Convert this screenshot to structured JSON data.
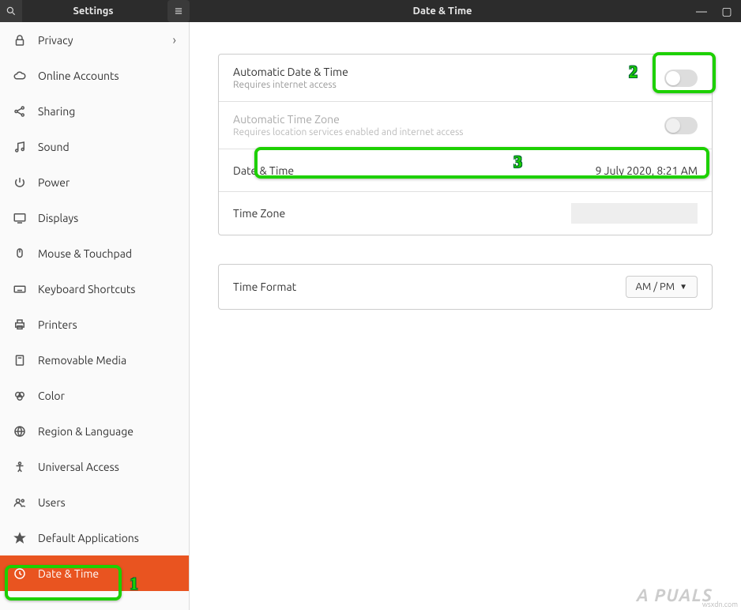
{
  "titlebar": {
    "app_title": "Settings",
    "window_title": "Date & Time"
  },
  "sidebar": {
    "items": [
      {
        "icon": "lock",
        "label": "Privacy",
        "has_submenu": true
      },
      {
        "icon": "cloud",
        "label": "Online Accounts"
      },
      {
        "icon": "share",
        "label": "Sharing"
      },
      {
        "icon": "music",
        "label": "Sound"
      },
      {
        "icon": "power",
        "label": "Power"
      },
      {
        "icon": "display",
        "label": "Displays"
      },
      {
        "icon": "mouse",
        "label": "Mouse & Touchpad"
      },
      {
        "icon": "keyboard",
        "label": "Keyboard Shortcuts"
      },
      {
        "icon": "printer",
        "label": "Printers"
      },
      {
        "icon": "drive",
        "label": "Removable Media"
      },
      {
        "icon": "color",
        "label": "Color"
      },
      {
        "icon": "globe",
        "label": "Region & Language"
      },
      {
        "icon": "person",
        "label": "Universal Access"
      },
      {
        "icon": "users",
        "label": "Users"
      },
      {
        "icon": "star",
        "label": "Default Applications"
      },
      {
        "icon": "clock",
        "label": "Date & Time",
        "active": true
      }
    ]
  },
  "main": {
    "auto_datetime": {
      "title": "Automatic Date & Time",
      "sub": "Requires internet access"
    },
    "auto_timezone": {
      "title": "Automatic Time Zone",
      "sub": "Requires location services enabled and internet access"
    },
    "datetime": {
      "title": "Date & Time",
      "value": "9 July 2020,  8:21 AM"
    },
    "timezone": {
      "title": "Time Zone"
    },
    "timeformat": {
      "title": "Time Format",
      "value": "AM / PM"
    }
  },
  "annotations": {
    "n1": "1",
    "n2": "2",
    "n3": "3"
  },
  "watermark": "A  PUALS",
  "credit": "wsxdn.com"
}
